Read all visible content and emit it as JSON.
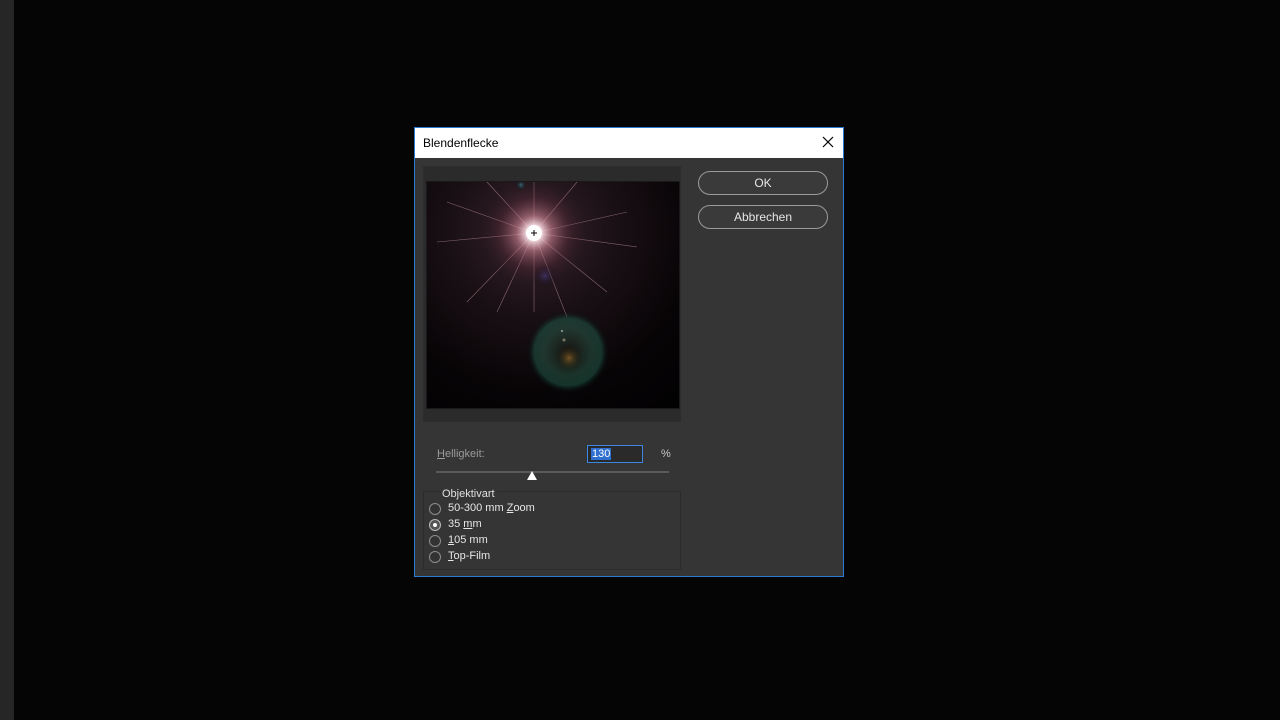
{
  "dialog": {
    "title": "Blendenflecke",
    "close_icon": "close-icon"
  },
  "buttons": {
    "ok_label": "OK",
    "cancel_label": "Abbrechen"
  },
  "brightness": {
    "label_prefix": "H",
    "label_rest": "elligkeit:",
    "value": "130",
    "unit": "%",
    "slider_value_percent": 130,
    "slider_fraction": 0.41
  },
  "lens_type": {
    "title": "Objektivart",
    "options": [
      {
        "label_a": "50-300 mm ",
        "label_u": "Z",
        "label_b": "oom",
        "selected": false
      },
      {
        "label_a": "35 ",
        "label_u": "m",
        "label_b": "m",
        "selected": true
      },
      {
        "label_a": "",
        "label_u": "1",
        "label_b": "05 mm",
        "selected": false
      },
      {
        "label_a": "",
        "label_u": "T",
        "label_b": "op-Film",
        "selected": false
      }
    ]
  },
  "colors": {
    "dialog_border": "#2a7ad6",
    "dialog_bg": "#353535",
    "selection_bg": "#2e6fd0"
  }
}
